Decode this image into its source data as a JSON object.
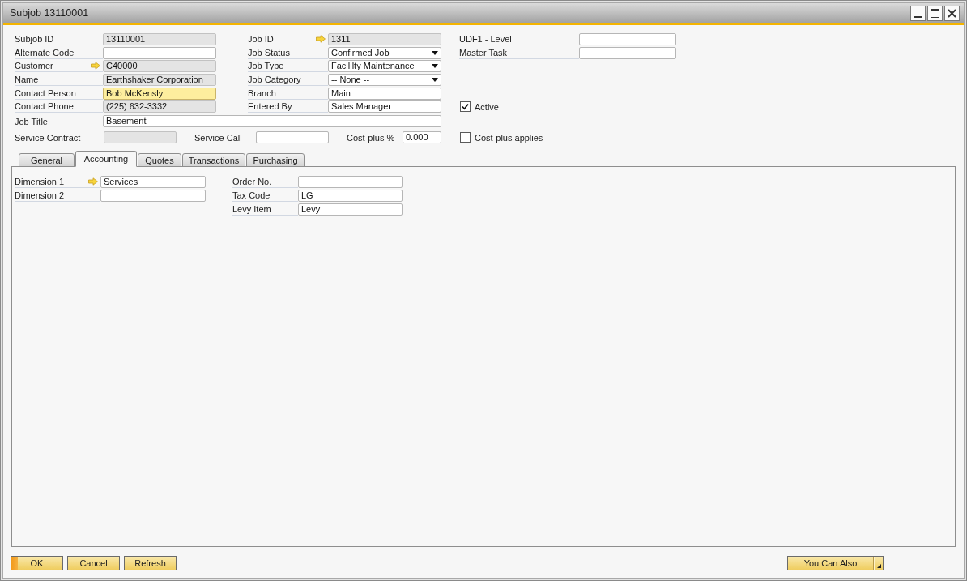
{
  "window": {
    "title": "Subjob 13110001"
  },
  "header": {
    "columns": [
      {
        "fields": [
          {
            "label": "Subjob ID",
            "value": "13110001",
            "kind": "readonly",
            "linked": false,
            "focused": false
          },
          {
            "label": "Alternate Code",
            "kind": "text",
            "linked": false,
            "focused": false
          },
          {
            "label": "Customer",
            "value": "C40000",
            "kind": "readonly",
            "linked": true,
            "focused": false
          },
          {
            "label": "Name",
            "value": "Earthshaker Corporation",
            "kind": "readonly",
            "linked": false,
            "focused": false
          },
          {
            "label": "Contact Person",
            "value": "Bob McKensly",
            "kind": "text",
            "linked": false,
            "focused": true
          },
          {
            "label": "Contact Phone",
            "value": "(225) 632-3332",
            "kind": "readonly",
            "linked": false,
            "focused": false
          }
        ]
      },
      {
        "fields": [
          {
            "label": "Job ID",
            "value": "1311",
            "kind": "readonly",
            "linked": true,
            "focused": false
          },
          {
            "label": "Job Status",
            "value": "Confirmed Job",
            "kind": "dropdown",
            "linked": false,
            "focused": false
          },
          {
            "label": "Job Type",
            "value": "Facililty Maintenance",
            "kind": "dropdown",
            "linked": false,
            "focused": false
          },
          {
            "label": "Job Category",
            "value": "-- None --",
            "kind": "dropdown",
            "linked": false,
            "focused": false
          },
          {
            "label": "Branch",
            "value": "Main",
            "kind": "text",
            "linked": false,
            "focused": false
          },
          {
            "label": "Entered By",
            "value": "Sales Manager",
            "kind": "text",
            "linked": false,
            "focused": false
          }
        ]
      },
      {
        "fields": [
          {
            "label": "UDF1 - Level",
            "kind": "text",
            "linked": false,
            "focused": false
          },
          {
            "label": "Master Task",
            "kind": "text",
            "linked": false,
            "focused": false
          }
        ],
        "checkbox": {
          "label": "Active",
          "checked": true
        }
      }
    ],
    "job_title": {
      "label": "Job Title",
      "value": "Basement",
      "kind": "text",
      "linked": false,
      "focused": false
    },
    "service_row": {
      "fields": [
        {
          "label": "Service Contract",
          "kind": "readonly",
          "linked": false,
          "focused": false
        },
        {
          "label": "Service Call",
          "kind": "text",
          "linked": false,
          "focused": false
        },
        {
          "label": "Cost-plus %",
          "value": "0.000",
          "kind": "text",
          "linked": false,
          "focused": false
        }
      ],
      "checkbox": {
        "label": "Cost-plus applies",
        "checked": false
      }
    }
  },
  "tabs": [
    {
      "label": "General",
      "selected": false
    },
    {
      "label": "Accounting",
      "selected": true
    },
    {
      "label": "Quotes",
      "selected": false
    },
    {
      "label": "Transactions",
      "selected": false
    },
    {
      "label": "Purchasing",
      "selected": false
    }
  ],
  "accounting": {
    "columns": [
      {
        "fields": [
          {
            "label": "Dimension 1",
            "value": "Services",
            "kind": "text",
            "linked": true,
            "focused": false
          },
          {
            "label": "Dimension 2",
            "kind": "text",
            "linked": false,
            "focused": false
          }
        ]
      },
      {
        "fields": [
          {
            "label": "Order No.",
            "kind": "text",
            "linked": false,
            "focused": false
          },
          {
            "label": "Tax Code",
            "value": "LG",
            "kind": "text",
            "linked": false,
            "focused": false
          },
          {
            "label": "Levy Item",
            "value": "Levy",
            "kind": "text",
            "linked": false,
            "focused": false
          }
        ]
      }
    ]
  },
  "footer": {
    "buttons": [
      {
        "label": "OK",
        "default": true
      },
      {
        "label": "Cancel",
        "default": false
      },
      {
        "label": "Refresh",
        "default": false
      }
    ],
    "menu_button": {
      "label": "You Can Also"
    }
  }
}
